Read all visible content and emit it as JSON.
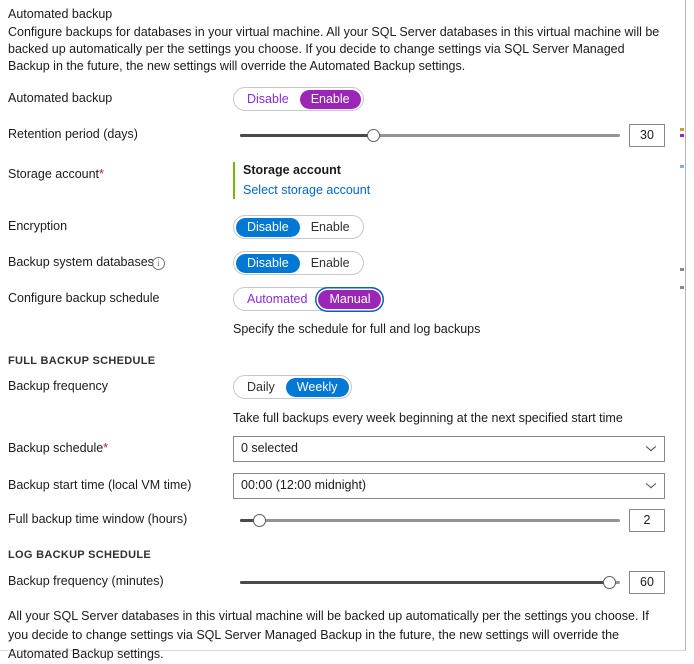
{
  "panel": {
    "title": "Automated backup",
    "description": "Configure backups for databases in your virtual machine. All your SQL Server databases in this virtual machine will be backed up automatically per the settings you choose. If you decide to change settings via SQL Server Managed Backup in the future, the new settings will override the Automated Backup settings.",
    "footer": "All your SQL Server databases in this virtual machine will be backed up automatically per the settings you choose. If you decide to change settings via SQL Server Managed Backup in the future, the new settings will override the Automated Backup settings."
  },
  "colors": {
    "accent_purple": "#9b26b6",
    "accent_blue": "#0078d4",
    "link_blue": "#0066cc",
    "required_red": "#a4262c",
    "storage_bar_green": "#7ab800",
    "focus_ring_blue": "#0a5fb8"
  },
  "automated_backup": {
    "label": "Automated backup",
    "options": [
      "Disable",
      "Enable"
    ],
    "selected": "Enable"
  },
  "retention": {
    "label": "Retention period (days)",
    "value": "30",
    "percent": 35
  },
  "storage_account": {
    "label": "Storage account",
    "required_marker": "*",
    "heading": "Storage account",
    "link": "Select storage account"
  },
  "encryption": {
    "label": "Encryption",
    "options": [
      "Disable",
      "Enable"
    ],
    "selected": "Disable"
  },
  "system_databases": {
    "label": "Backup system databases",
    "info_icon": "info-icon",
    "options": [
      "Disable",
      "Enable"
    ],
    "selected": "Disable"
  },
  "configure_schedule": {
    "label": "Configure backup schedule",
    "options": [
      "Automated",
      "Manual"
    ],
    "selected": "Manual",
    "helper": "Specify the schedule for full and log backups"
  },
  "full_backup_section": {
    "heading": "FULL BACKUP SCHEDULE",
    "frequency": {
      "label": "Backup frequency",
      "options": [
        "Daily",
        "Weekly"
      ],
      "selected": "Weekly",
      "helper": "Take full backups every week beginning at the next specified start time"
    },
    "schedule": {
      "label": "Backup schedule",
      "required_marker": "*",
      "value": "0 selected"
    },
    "start_time": {
      "label": "Backup start time (local VM time)",
      "value": "00:00 (12:00 midnight)"
    },
    "time_window": {
      "label": "Full backup time window (hours)",
      "value": "2",
      "percent": 5
    }
  },
  "log_backup_section": {
    "heading": "LOG BACKUP SCHEDULE",
    "frequency": {
      "label": "Backup frequency (minutes)",
      "value": "60",
      "percent": 97
    }
  }
}
